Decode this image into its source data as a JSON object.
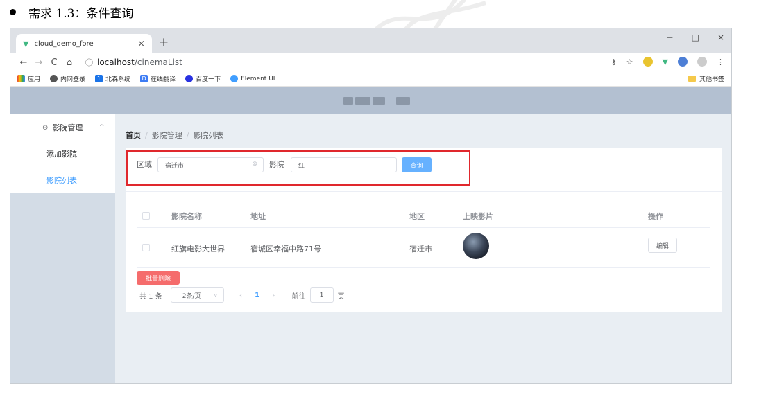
{
  "doc_heading": "需求 1.3：条件查询",
  "browser": {
    "tab_title": "cloud_demo_fore",
    "tab_close": "×",
    "new_tab": "+",
    "url_host": "localhost",
    "url_path": "/cinemaList",
    "win_minimize": "−",
    "win_maximize": "□",
    "win_close": "×"
  },
  "bookmarks": {
    "items": [
      "应用",
      "内网登录",
      "北森系统",
      "在线翻译",
      "百度一下",
      "Element UI"
    ],
    "other": "其他书签"
  },
  "sidebar": {
    "group_title": "影院管理",
    "items": [
      {
        "label": "添加影院"
      },
      {
        "label": "影院列表"
      }
    ]
  },
  "breadcrumb": [
    "首页",
    "影院管理",
    "影院列表"
  ],
  "search": {
    "region_label": "区域",
    "region_value": "宿迁市",
    "cinema_label": "影院",
    "cinema_value": "红",
    "query_button": "查询"
  },
  "table": {
    "headers": [
      "影院名称",
      "地址",
      "地区",
      "上映影片",
      "操作"
    ],
    "rows": [
      {
        "name": "红旗电影大世界",
        "address": "宿城区幸福中路71号",
        "region": "宿迁市",
        "edit": "编辑"
      }
    ]
  },
  "batch_delete": "批量删除",
  "pagination": {
    "total": "共 1 条",
    "page_size": "2条/页",
    "current_page": "1",
    "goto_prefix": "前往",
    "goto_value": "1",
    "goto_suffix": "页"
  },
  "colors": {
    "accent": "#409eff",
    "header_bg": "#b3c0d1",
    "aside_bg": "#d3dce6",
    "main_bg": "#e9eef3",
    "danger": "#f56c6c",
    "highlight": "#e0282d"
  }
}
